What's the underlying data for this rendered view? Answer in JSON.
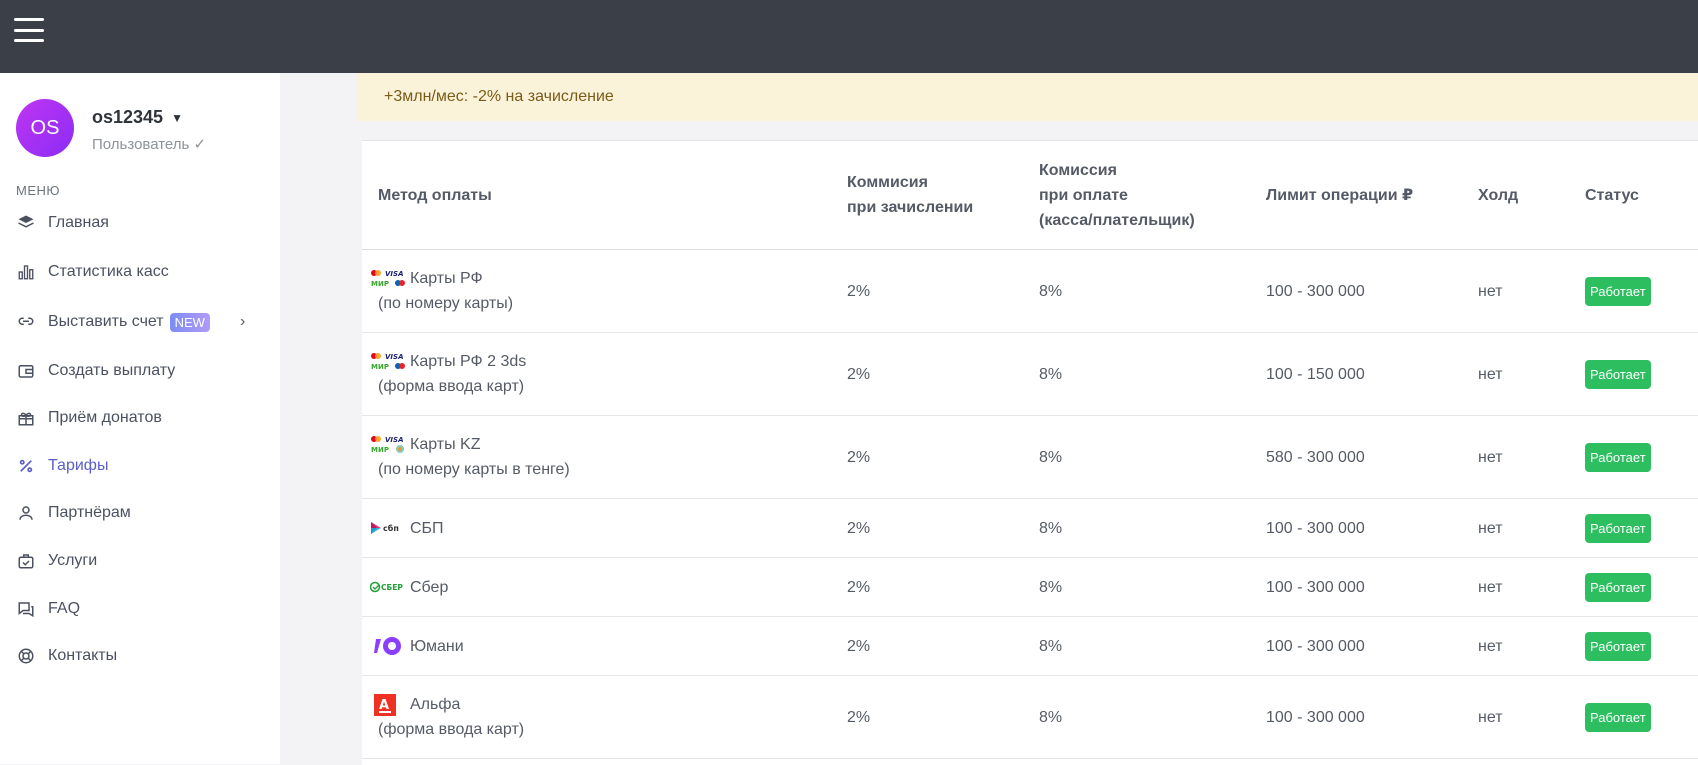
{
  "user": {
    "initials": "OS",
    "name": "os12345",
    "role": "Пользователь ✓"
  },
  "menu": {
    "caption": "МЕНЮ",
    "items": [
      {
        "label": "Главная",
        "icon": "layers-icon"
      },
      {
        "label": "Статистика касс",
        "icon": "bar-chart-icon"
      },
      {
        "label": "Выставить счет",
        "icon": "link-icon",
        "badge": "NEW"
      },
      {
        "label": "Создать выплату",
        "icon": "wallet-icon"
      },
      {
        "label": "Приём донатов",
        "icon": "gift-icon"
      },
      {
        "label": "Тарифы",
        "icon": "percent-icon",
        "active": true
      },
      {
        "label": "Партнёрам",
        "icon": "user-icon"
      },
      {
        "label": "Услуги",
        "icon": "briefcase-check-icon"
      },
      {
        "label": "FAQ",
        "icon": "chat-icon"
      },
      {
        "label": "Контакты",
        "icon": "lifebuoy-icon"
      }
    ]
  },
  "notice": "+3млн/мес: -2% на зачисление",
  "table": {
    "headers": {
      "method": "Метод оплаты",
      "commission_in_1": "Коммисия",
      "commission_in_2": "при зачислении",
      "commission_pay_1": "Комиссия",
      "commission_pay_2": "при оплате",
      "commission_pay_3": "(касса/плательщик)",
      "limit": "Лимит операции ₽",
      "hold": "Холд",
      "status": "Статус"
    },
    "rows": [
      {
        "title": "Карты РФ",
        "sub": "(по номеру карты)",
        "logo": "mir-visa-mc-logo",
        "commission_in": "2%",
        "commission_pay": "8%",
        "limit": "100 - 300 000",
        "hold": "нет",
        "status": "Работает"
      },
      {
        "title": "Карты РФ 2 3ds",
        "sub": "(форма ввода карт)",
        "logo": "mir-visa-mc-logo",
        "commission_in": "2%",
        "commission_pay": "8%",
        "limit": "100 - 150 000",
        "hold": "нет",
        "status": "Работает"
      },
      {
        "title": "Карты KZ",
        "sub": "(по номеру карты в тенге)",
        "logo": "mir-visa-kz-logo",
        "commission_in": "2%",
        "commission_pay": "8%",
        "limit": "580 - 300 000",
        "hold": "нет",
        "status": "Работает"
      },
      {
        "title": "СБП",
        "sub": "",
        "logo": "sbp-logo",
        "logo_text": "сбп",
        "commission_in": "2%",
        "commission_pay": "8%",
        "limit": "100 - 300 000",
        "hold": "нет",
        "status": "Работает"
      },
      {
        "title": "Сбер",
        "sub": "",
        "logo": "sber-logo",
        "logo_text": "СБЕР",
        "commission_in": "2%",
        "commission_pay": "8%",
        "limit": "100 - 300 000",
        "hold": "нет",
        "status": "Работает"
      },
      {
        "title": "Юмани",
        "sub": "",
        "logo": "yoomoney-logo",
        "commission_in": "2%",
        "commission_pay": "8%",
        "limit": "100 - 300 000",
        "hold": "нет",
        "status": "Работает"
      },
      {
        "title": "Альфа",
        "sub": "(форма ввода карт)",
        "logo": "alfa-logo",
        "logo_text": "А",
        "commission_in": "2%",
        "commission_pay": "8%",
        "limit": "100 - 300 000",
        "hold": "нет",
        "status": "Работает"
      }
    ]
  },
  "colors": {
    "topbar": "#3a3f48",
    "accent": "#5b5fc7",
    "status_ok": "#2dbe60",
    "notice_bg": "#fbf3d9"
  }
}
